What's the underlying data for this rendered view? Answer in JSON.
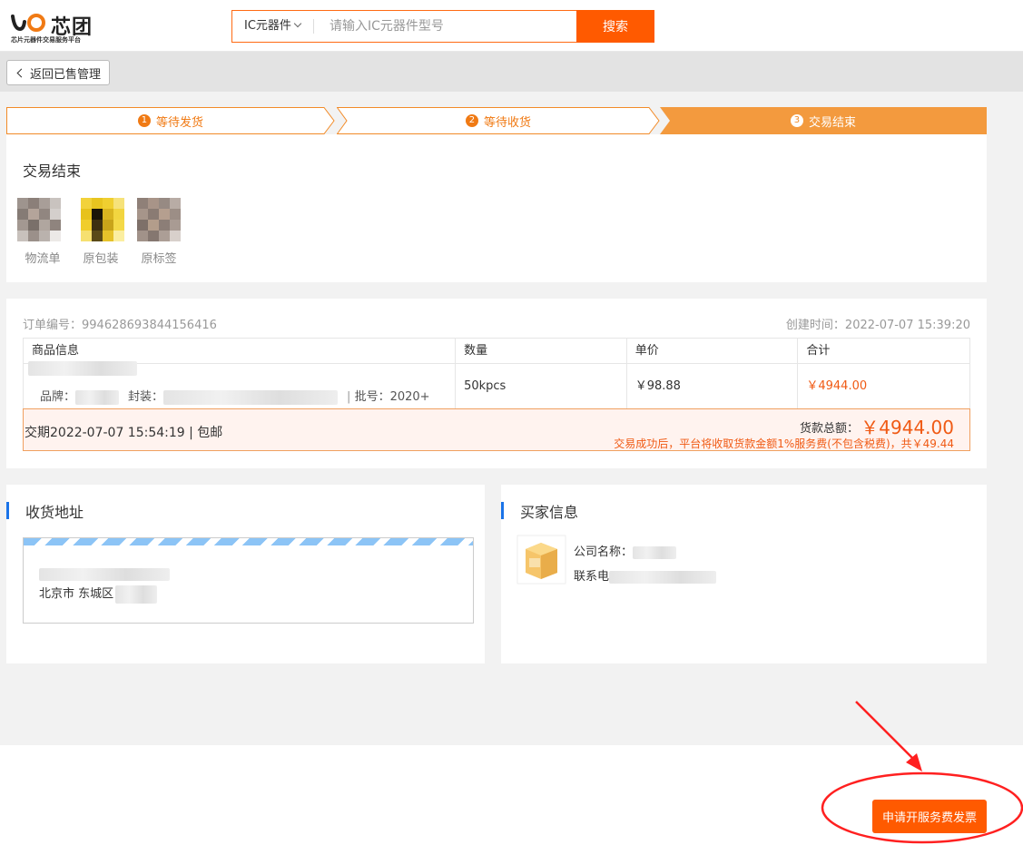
{
  "header": {
    "logo_text": "芯团",
    "logo_sub": "芯片元器件交易服务平台",
    "search_category": "IC元器件",
    "search_placeholder": "请输入IC元器件型号",
    "search_button": "搜索"
  },
  "back_button": "返回已售管理",
  "steps": [
    {
      "num": "1",
      "label": "等待发货",
      "active": false
    },
    {
      "num": "2",
      "label": "等待收货",
      "active": false
    },
    {
      "num": "3",
      "label": "交易结束",
      "active": true
    }
  ],
  "status": {
    "title": "交易结束",
    "images": [
      {
        "label": "物流单"
      },
      {
        "label": "原包装"
      },
      {
        "label": "原标签"
      }
    ]
  },
  "order": {
    "order_no": "订单编号：994628693844156416",
    "created": "创建时间：2022-07-07 15:39:20",
    "headers": [
      "商品信息",
      "数量",
      "单价",
      "合计"
    ],
    "brand_label": "品牌：",
    "package_label": "封装：",
    "batch": "批号：2020+",
    "quantity": "50kpcs",
    "unit_price": "￥98.88",
    "subtotal": "￥4944.00",
    "period": "交期2022-07-07 15:54:19 | 包邮",
    "total_label": "货款总额：",
    "total_value": "￥4944.00",
    "fee_note": "交易成功后，平台将收取货款金额1%服务费(不包含税费)，共￥49.44"
  },
  "shipping": {
    "title": "收货地址",
    "city": "北京市 东城区"
  },
  "buyer": {
    "title": "买家信息",
    "company_label": "公司名称：",
    "phone_label": "联系电"
  },
  "apply_invoice_button": "申请开服务费发票",
  "colors": {
    "accent": "#ff5a00",
    "step_active": "#f39a3e",
    "info_bar": "#1a73e8"
  }
}
